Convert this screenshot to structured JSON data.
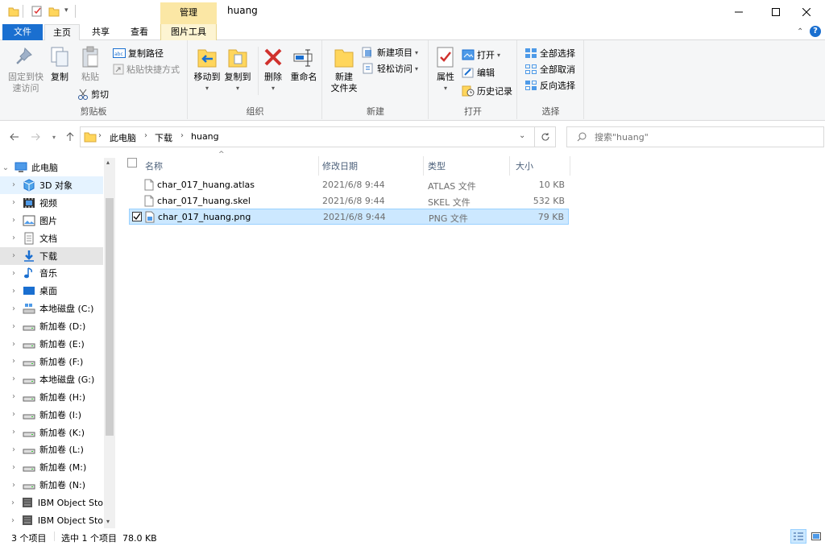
{
  "window": {
    "title": "huang",
    "context_tab": "管理"
  },
  "tabs": {
    "file": "文件",
    "home": "主页",
    "share": "共享",
    "view": "查看",
    "picture_tools": "图片工具"
  },
  "ribbon": {
    "clipboard": {
      "pin": "固定到快速访问",
      "pin_l1": "固定到快",
      "pin_l2": "速访问",
      "copy": "复制",
      "paste": "粘贴",
      "copy_path": "复制路径",
      "paste_shortcut": "粘贴快捷方式",
      "cut": "剪切",
      "label": "剪贴板"
    },
    "organize": {
      "move_to": "移动到",
      "copy_to": "复制到",
      "delete": "删除",
      "rename": "重命名",
      "label": "组织"
    },
    "new": {
      "new_folder_l1": "新建",
      "new_folder_l2": "文件夹",
      "new_item": "新建项目",
      "easy_access": "轻松访问",
      "label": "新建"
    },
    "open": {
      "properties": "属性",
      "open": "打开",
      "edit": "编辑",
      "history": "历史记录",
      "label": "打开"
    },
    "select": {
      "select_all": "全部选择",
      "select_none": "全部取消",
      "invert": "反向选择",
      "label": "选择"
    }
  },
  "address": {
    "crumbs": [
      "此电脑",
      "下载",
      "huang"
    ],
    "search_placeholder": "搜索\"huang\""
  },
  "nav": [
    {
      "label": "此电脑",
      "icon": "pc-icon",
      "level": 0,
      "expanded": true
    },
    {
      "label": "3D 对象",
      "icon": "3d-objects-icon",
      "level": 1,
      "state": "hot"
    },
    {
      "label": "视频",
      "icon": "video-icon",
      "level": 1
    },
    {
      "label": "图片",
      "icon": "pictures-icon",
      "level": 1
    },
    {
      "label": "文档",
      "icon": "documents-icon",
      "level": 1
    },
    {
      "label": "下载",
      "icon": "downloads-icon",
      "level": 1,
      "state": "selected"
    },
    {
      "label": "音乐",
      "icon": "music-icon",
      "level": 1
    },
    {
      "label": "桌面",
      "icon": "desktop-icon",
      "level": 1
    },
    {
      "label": "本地磁盘 (C:)",
      "icon": "system-drive-icon",
      "level": 1
    },
    {
      "label": "新加卷 (D:)",
      "icon": "drive-icon",
      "level": 1
    },
    {
      "label": "新加卷 (E:)",
      "icon": "drive-icon",
      "level": 1
    },
    {
      "label": "新加卷 (F:)",
      "icon": "drive-icon",
      "level": 1
    },
    {
      "label": "本地磁盘 (G:)",
      "icon": "drive-icon",
      "level": 1
    },
    {
      "label": "新加卷 (H:)",
      "icon": "drive-icon",
      "level": 1
    },
    {
      "label": "新加卷 (I:)",
      "icon": "drive-icon",
      "level": 1
    },
    {
      "label": "新加卷 (K:)",
      "icon": "drive-icon",
      "level": 1
    },
    {
      "label": "新加卷 (L:)",
      "icon": "drive-icon",
      "level": 1
    },
    {
      "label": "新加卷 (M:)",
      "icon": "drive-icon",
      "level": 1
    },
    {
      "label": "新加卷 (N:)",
      "icon": "drive-icon",
      "level": 1
    },
    {
      "label": "IBM Object Sto",
      "icon": "network-drive-icon",
      "level": 1
    },
    {
      "label": "IBM Object Sto",
      "icon": "network-drive-icon",
      "level": 1
    }
  ],
  "columns": {
    "name": "名称",
    "date": "修改日期",
    "type": "类型",
    "size": "大小"
  },
  "files": [
    {
      "name": "char_017_huang.atlas",
      "date": "2021/6/8 9:44",
      "type": "ATLAS 文件",
      "size": "10 KB",
      "selected": false
    },
    {
      "name": "char_017_huang.skel",
      "date": "2021/6/8 9:44",
      "type": "SKEL 文件",
      "size": "532 KB",
      "selected": false
    },
    {
      "name": "char_017_huang.png",
      "date": "2021/6/8 9:44",
      "type": "PNG 文件",
      "size": "79 KB",
      "selected": true
    }
  ],
  "status": {
    "count": "3 个项目",
    "selection": "选中 1 个项目  78.0 KB"
  },
  "colors": {
    "accent": "#1a6fd0",
    "selection": "#cce8ff",
    "context_tab": "#fbe7a5",
    "folder": "#ffd65c"
  }
}
